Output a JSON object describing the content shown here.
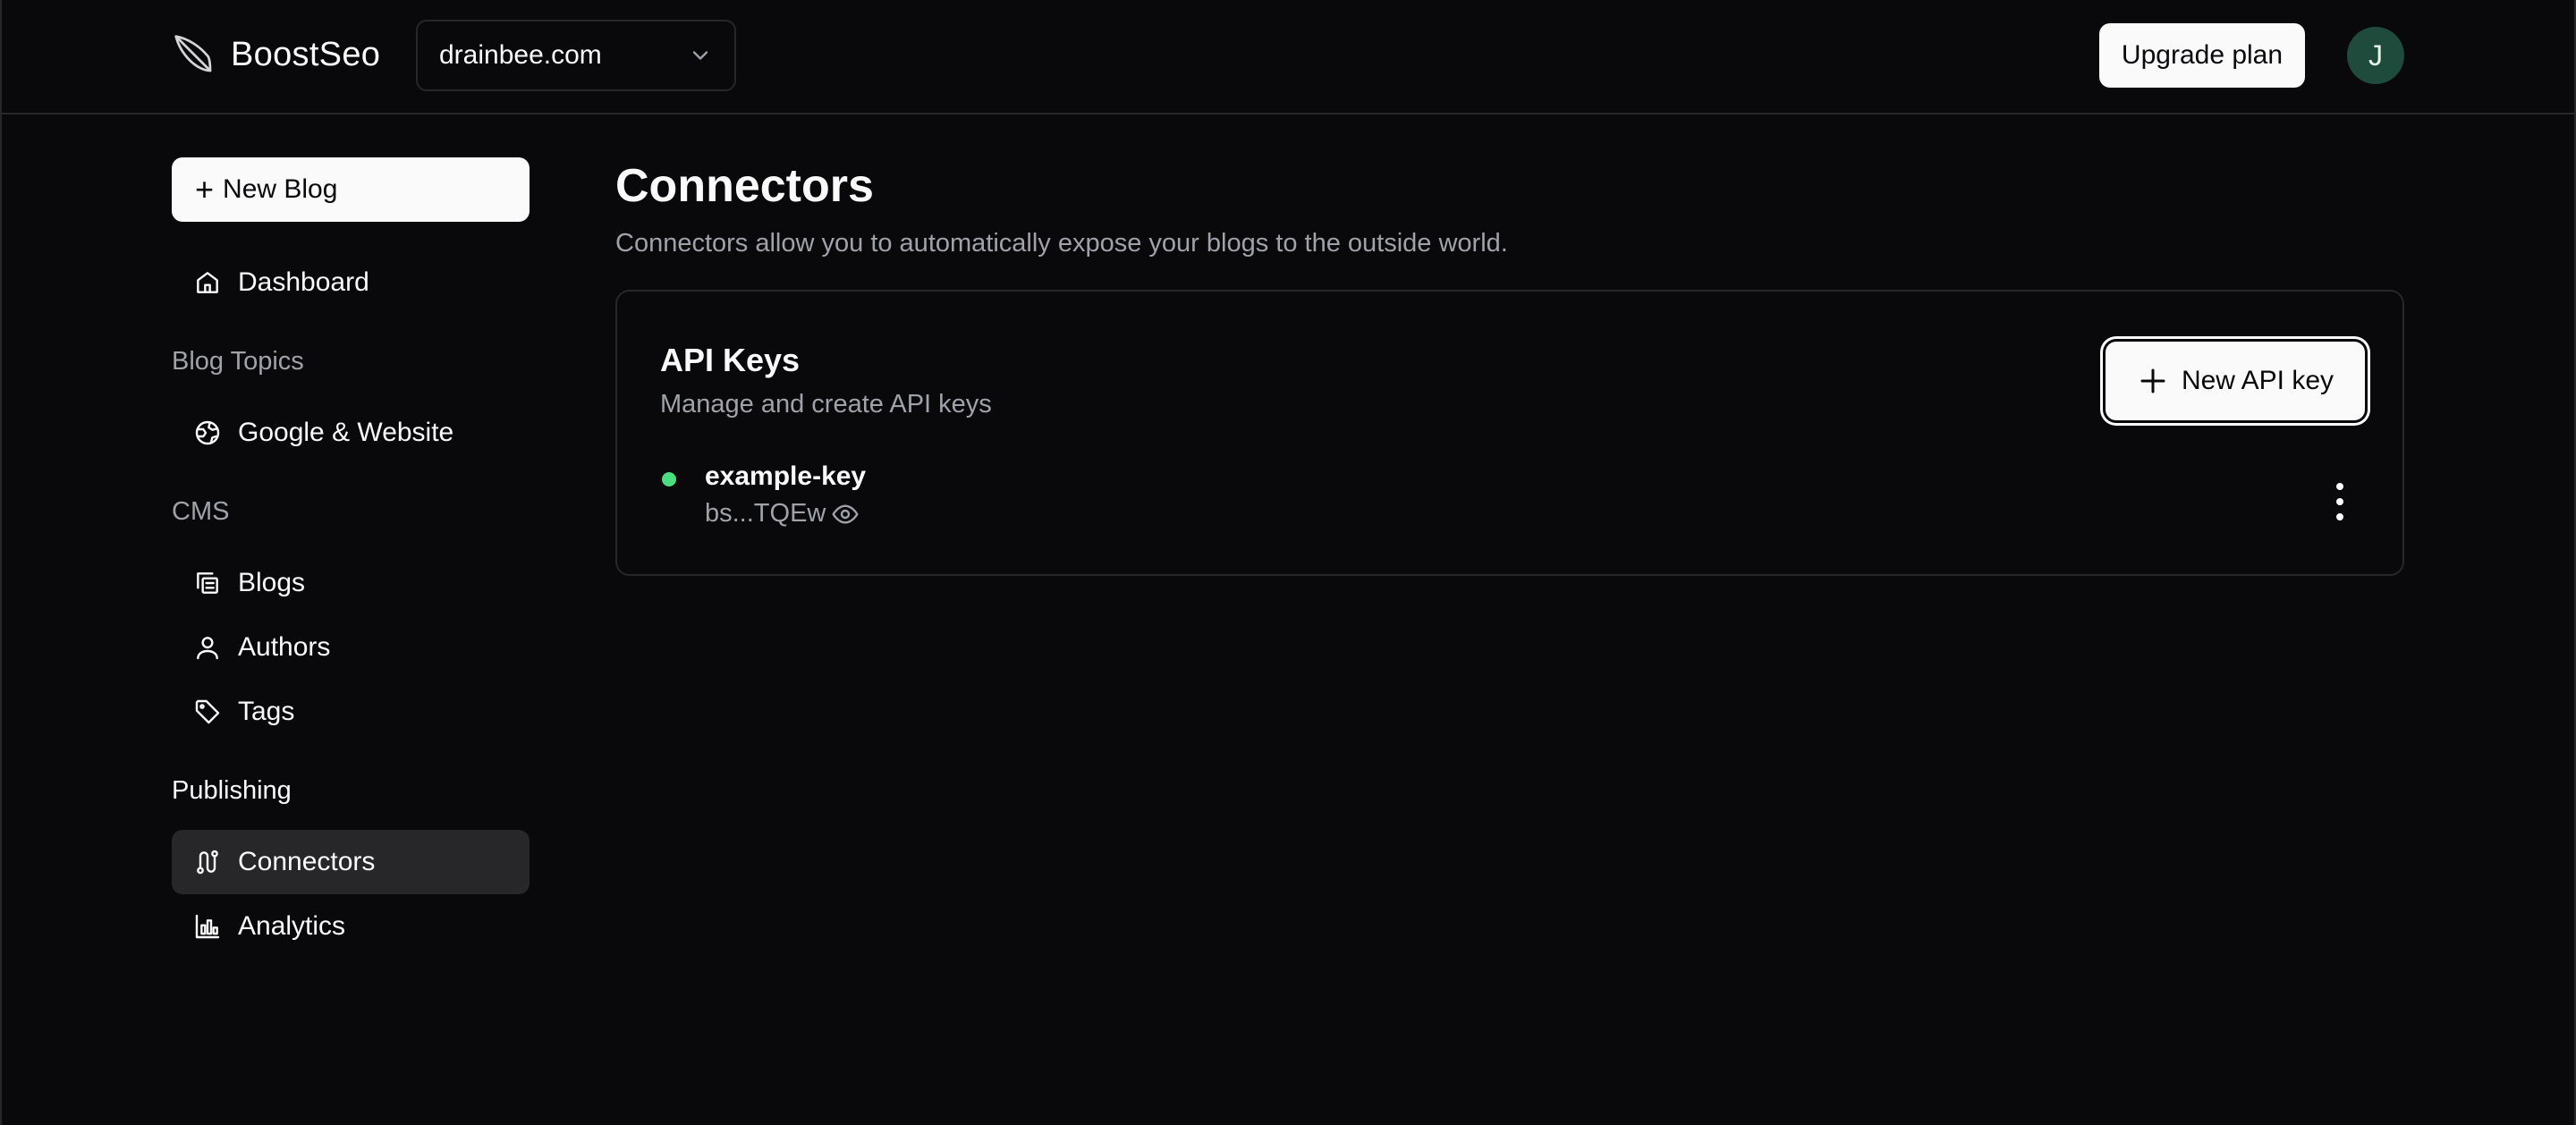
{
  "header": {
    "brand": "BoostSeo",
    "site_selector": {
      "value": "drainbee.com"
    },
    "upgrade_label": "Upgrade plan",
    "avatar_initial": "J"
  },
  "sidebar": {
    "new_blog_label": "New Blog",
    "dashboard": "Dashboard",
    "sections": {
      "blog_topics": "Blog Topics",
      "cms": "CMS",
      "publishing": "Publishing"
    },
    "items": {
      "google_website": "Google & Website",
      "blogs": "Blogs",
      "authors": "Authors",
      "tags": "Tags",
      "connectors": "Connectors",
      "analytics": "Analytics"
    },
    "active": "Connectors"
  },
  "main": {
    "title": "Connectors",
    "description": "Connectors allow you to automatically expose your blogs to the outside world.",
    "api_keys_card": {
      "title": "API Keys",
      "subtitle": "Manage and create API keys",
      "new_key_label": "New API key",
      "keys": [
        {
          "name": "example-key",
          "masked": "bs...TQEw",
          "status_color": "#4ade80"
        }
      ]
    }
  },
  "colors": {
    "background": "#09090b",
    "border": "#27272a",
    "muted_text": "#a1a1aa",
    "avatar_bg": "#1f4b3d",
    "status_active": "#4ade80"
  }
}
